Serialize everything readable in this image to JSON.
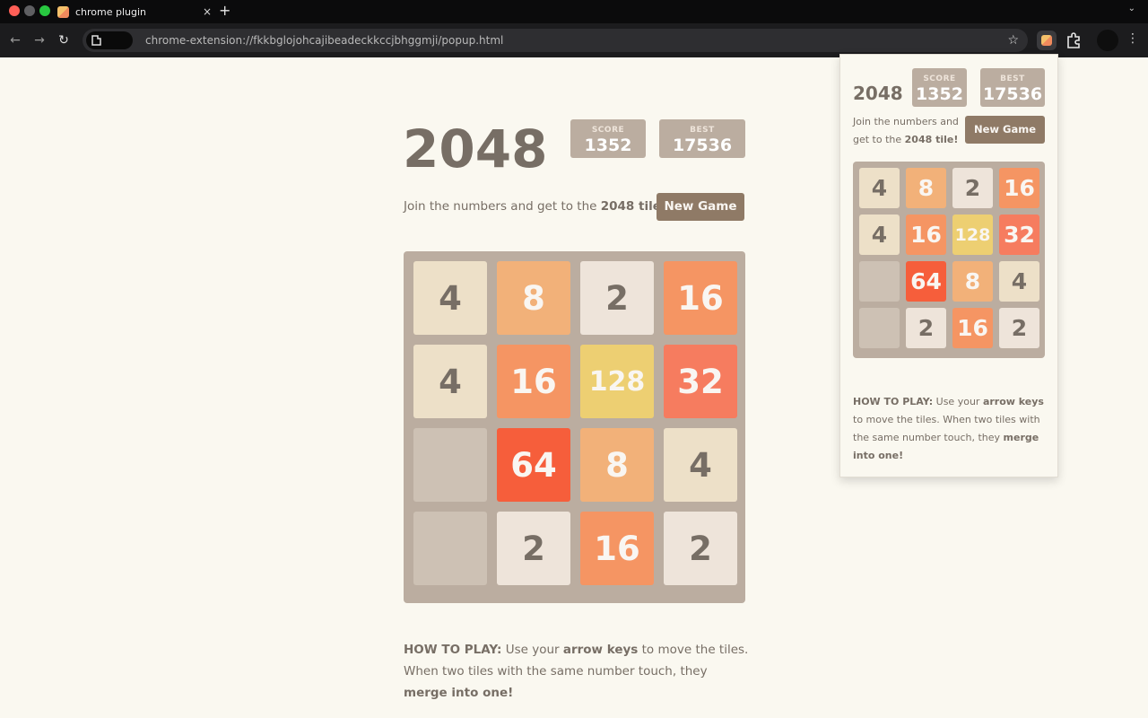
{
  "browser": {
    "tab_title": "chrome plugin",
    "tab_close": "×",
    "new_tab": "+",
    "url": "chrome-extension://fkkbglojohcajibeadeckkccjbhggmji/popup.html",
    "bookmark_icon": "☆",
    "back_icon": "←",
    "forward_icon": "→",
    "reload_icon": "↻",
    "menu_icon": "⋮",
    "tabs_menu_icon": "⌄"
  },
  "game": {
    "title": "2048",
    "score_label": "SCORE",
    "score": "1352",
    "best_label": "BEST",
    "best": "17536",
    "intro_prefix": "Join the numbers and get to the ",
    "intro_bold": "2048 tile!",
    "new_game": "New Game",
    "grid": [
      [
        "4",
        "8",
        "2",
        "16"
      ],
      [
        "4",
        "16",
        "128",
        "32"
      ],
      [
        "",
        "64",
        "8",
        "4"
      ],
      [
        "",
        "2",
        "16",
        "2"
      ]
    ],
    "howto": {
      "label": "HOW TO PLAY:",
      "text1": " Use your ",
      "bold1": "arrow keys",
      "text2": " to move the tiles. When two tiles with the same number touch, they ",
      "bold2": "merge into one!"
    }
  },
  "popup": {
    "title": "2048",
    "score_label": "SCORE",
    "score": "1352",
    "best_label": "BEST",
    "best": "17536",
    "intro_prefix": "Join the numbers and get to the ",
    "intro_bold": "2048 tile!",
    "new_game": "New Game"
  },
  "colors": {
    "board": "#bbada0",
    "empty_cell": "#cdc1b4",
    "button": "#8f7a66",
    "text_dark": "#776e65"
  }
}
